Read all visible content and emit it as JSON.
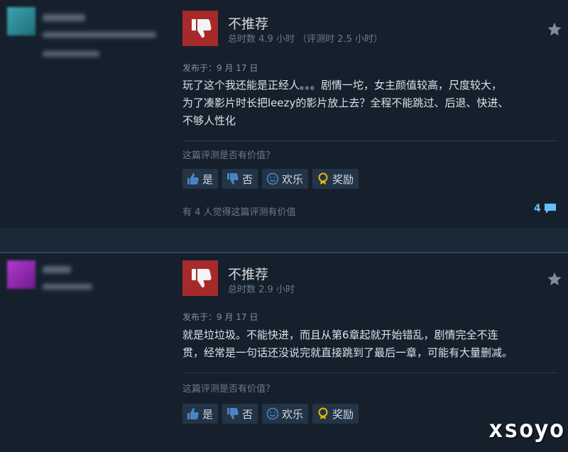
{
  "reviews": [
    {
      "verdict": "不推荐",
      "hours": "总时数 4.9 小时 （评测时 2.5 小时）",
      "posted": "发布于：9 月 17 日",
      "lines": [
        "玩了这个我还能是正经人。。。剧情一坨，女主颜值较高，尺度较大，",
        "为了凑影片时长把leezy的影片放上去？全程不能跳过、后退、快进、",
        "不够人性化"
      ],
      "helpful_question": "这篇评测是否有价值？",
      "buttons": {
        "yes": "是",
        "no": "否",
        "funny": "欢乐",
        "award": "奖励"
      },
      "helpful_count": "有 4 人觉得这篇评测有价值",
      "comment_count": "4",
      "avatar_color": "#2f8c9a"
    },
    {
      "verdict": "不推荐",
      "hours": "总时数 2.9 小时",
      "posted": "发布于：9 月 17 日",
      "lines": [
        "就是垃垃圾。不能快进，而且从第6章起就开始错乱，剧情完全不连",
        "贯，经常是一句话还没说完就直接跳到了最后一章，可能有大量删减。"
      ],
      "helpful_question": "这篇评测是否有价值？",
      "buttons": {
        "yes": "是",
        "no": "否",
        "funny": "欢乐",
        "award": "奖励"
      },
      "avatar_color": "#9b2fb0"
    }
  ],
  "watermark": "xsoyo",
  "colors": {
    "thumb_bg": "#a72a2a",
    "link_blue": "#66c0f4",
    "panel": "#16202d"
  }
}
